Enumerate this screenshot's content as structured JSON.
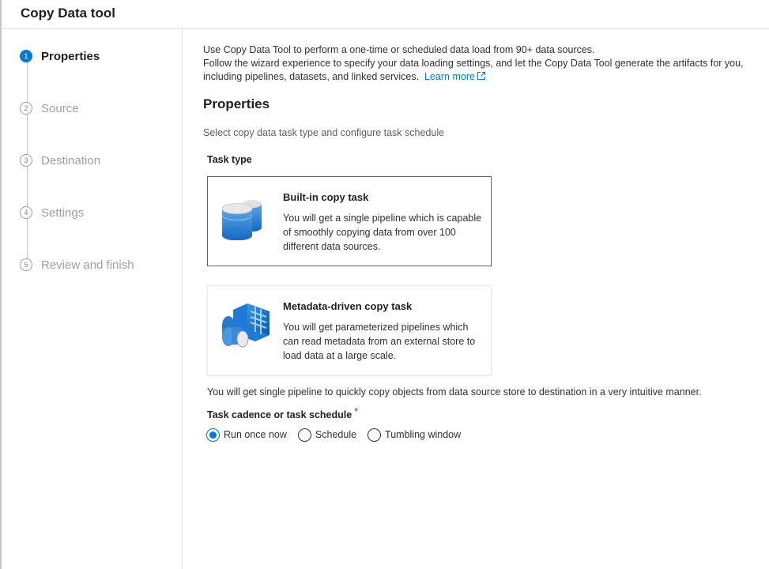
{
  "header": {
    "title": "Copy Data tool"
  },
  "steps": [
    {
      "num": "1",
      "label": "Properties"
    },
    {
      "num": "2",
      "label": "Source"
    },
    {
      "num": "3",
      "label": "Destination"
    },
    {
      "num": "4",
      "label": "Settings"
    },
    {
      "num": "5",
      "label": "Review and finish"
    }
  ],
  "intro": {
    "line1": "Use Copy Data Tool to perform a one-time or scheduled data load from 90+ data sources.",
    "line2": "Follow the wizard experience to specify your data loading settings, and let the Copy Data Tool generate the artifacts for you, including pipelines, datasets, and linked services.",
    "learn_more": "Learn more"
  },
  "properties": {
    "title": "Properties",
    "description": "Select copy data task type and configure task schedule",
    "task_type_label": "Task type",
    "cards": [
      {
        "title": "Built-in copy task",
        "description": "You will get a single pipeline which is capable of smoothly copying data from over 100 different data sources.",
        "icon": "database-icon",
        "selected": true
      },
      {
        "title": "Metadata-driven copy task",
        "description": "You will get parameterized pipelines which can read metadata from an external store to load data at a large scale.",
        "icon": "metadata-table-icon",
        "selected": false
      }
    ],
    "card_note": "You will get single pipeline to quickly copy objects from data source store to destination in a very intuitive manner.",
    "cadence_label": "Task cadence or task schedule",
    "required_mark": "*",
    "cadence_options": [
      "Run once now",
      "Schedule",
      "Tumbling window"
    ],
    "cadence_selected": "Run once now"
  },
  "colors": {
    "accent": "#0078d4",
    "required": "#a4262c"
  }
}
